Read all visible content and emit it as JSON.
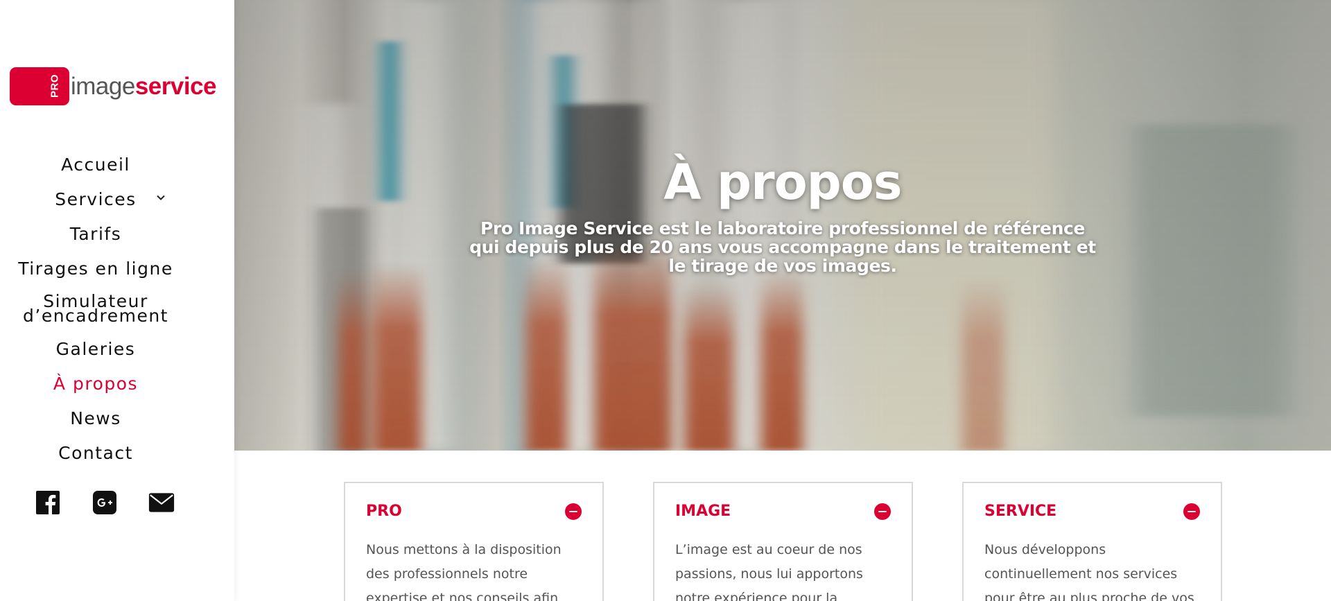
{
  "brand": {
    "logo_pro": "PRO",
    "logo_image": "image",
    "logo_service": "service",
    "accent_color": "#dc0032"
  },
  "nav": {
    "items": [
      {
        "label": "Accueil"
      },
      {
        "label": "Services",
        "has_submenu": true,
        "chevron": "chevron-down-icon"
      },
      {
        "label": "Tarifs"
      },
      {
        "label": "Tirages en ligne"
      },
      {
        "label_line1": "Simulateur",
        "label_line2": "d’encadrement"
      },
      {
        "label": "Galeries"
      },
      {
        "label": "À propos",
        "active": true
      },
      {
        "label": "News"
      },
      {
        "label": "Contact"
      }
    ]
  },
  "socials": [
    {
      "icon": "facebook-icon"
    },
    {
      "icon": "google-plus-icon"
    },
    {
      "icon": "email-icon"
    }
  ],
  "hero": {
    "title": "À propos",
    "subtitle": "Pro Image Service est le laboratoire professionnel de référence qui depuis plus de 20 ans vous accompagne dans le traitement et le tirage de vos images."
  },
  "cards": [
    {
      "title": "PRO",
      "toggle_icon": "minus-circle-icon",
      "body": "Nous mettons à la disposition des professionnels notre expertise et nos conseils afin"
    },
    {
      "title": "IMAGE",
      "toggle_icon": "minus-circle-icon",
      "body": "L’image est au coeur de nos passions, nous lui apportons notre expérience pour la"
    },
    {
      "title": "SERVICE",
      "toggle_icon": "minus-circle-icon",
      "body": "Nous développons continuellement nos services pour être au plus proche de vos"
    }
  ]
}
